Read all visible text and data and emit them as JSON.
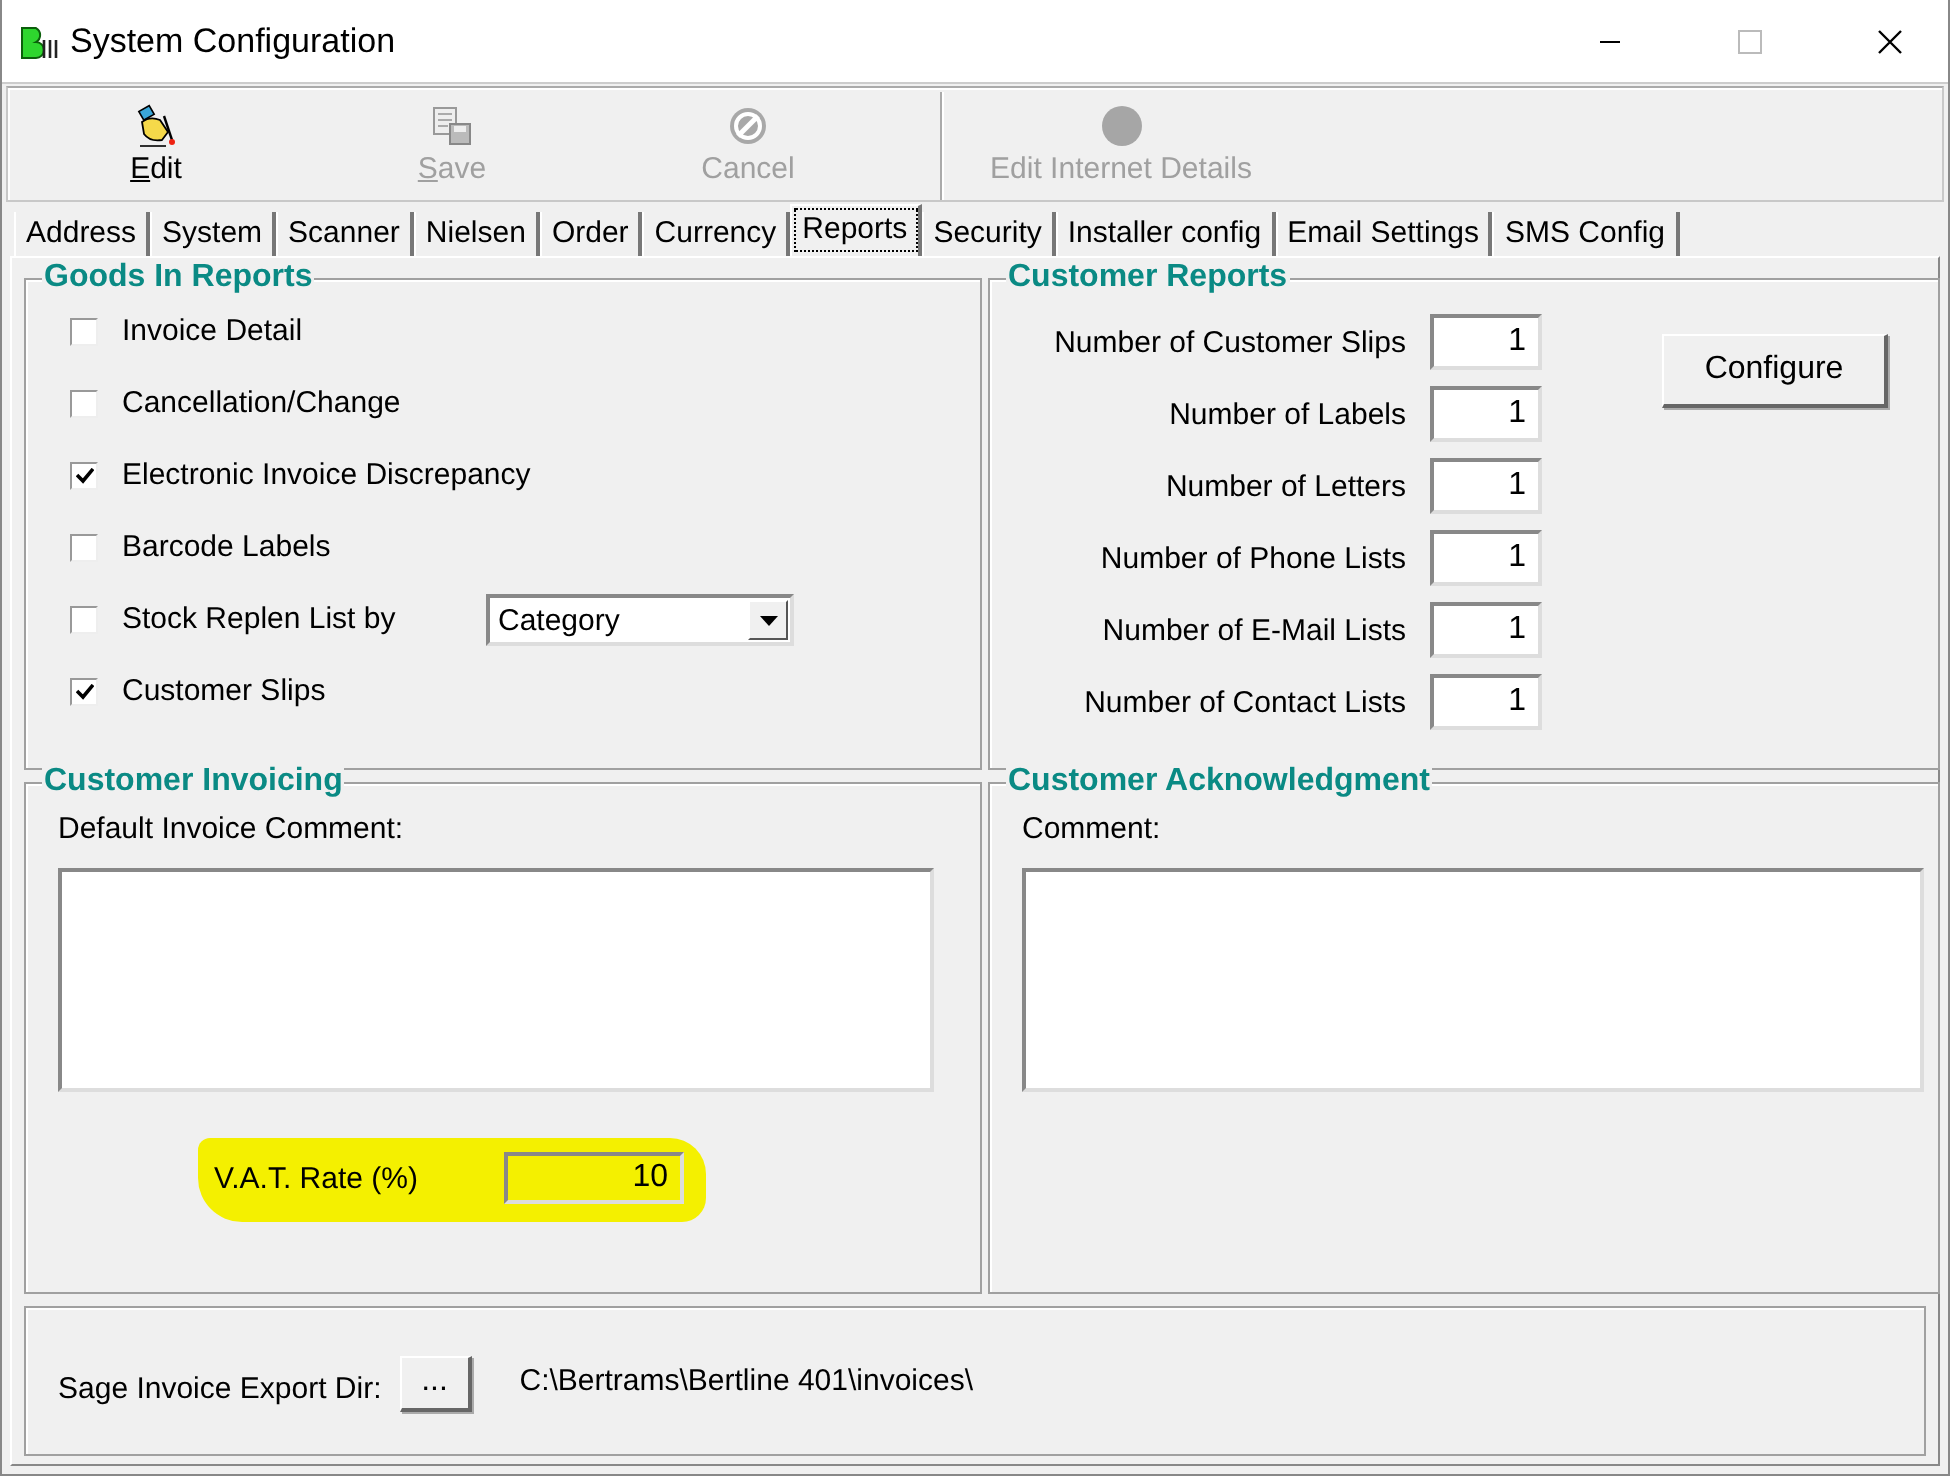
{
  "window": {
    "title": "System Configuration"
  },
  "toolbar": [
    {
      "label": "Edit",
      "kind": "edit",
      "disabled": false,
      "underline_first": true
    },
    {
      "label": "Save",
      "kind": "save",
      "disabled": true,
      "underline_first": true
    },
    {
      "label": "Cancel",
      "kind": "cancel",
      "disabled": true,
      "underline_first": false
    },
    {
      "label": "Edit Internet Details",
      "kind": "internet",
      "disabled": true,
      "underline_first": false
    }
  ],
  "tabs": [
    {
      "label": "Address",
      "selected": false
    },
    {
      "label": "System",
      "selected": false
    },
    {
      "label": "Scanner",
      "selected": false
    },
    {
      "label": "Nielsen",
      "selected": false
    },
    {
      "label": "Order",
      "selected": false
    },
    {
      "label": "Currency",
      "selected": false
    },
    {
      "label": "Reports",
      "selected": true
    },
    {
      "label": "Security",
      "selected": false
    },
    {
      "label": "Installer config",
      "selected": false
    },
    {
      "label": "Email Settings",
      "selected": false
    },
    {
      "label": "SMS Config",
      "selected": false
    }
  ],
  "goods_in_reports": {
    "title": "Goods In Reports",
    "options": [
      {
        "label": "Invoice Detail",
        "checked": false
      },
      {
        "label": "Cancellation/Change",
        "checked": false
      },
      {
        "label": "Electronic Invoice Discrepancy",
        "checked": true
      },
      {
        "label": "Barcode Labels",
        "checked": false
      },
      {
        "label": "Stock Replen List by",
        "checked": false,
        "dropdown": "Category"
      },
      {
        "label": "Customer Slips",
        "checked": true
      }
    ]
  },
  "customer_reports": {
    "title": "Customer Reports",
    "fields": [
      {
        "label": "Number of Customer Slips",
        "value": "1"
      },
      {
        "label": "Number of Labels",
        "value": "1"
      },
      {
        "label": "Number of Letters",
        "value": "1"
      },
      {
        "label": "Number of Phone Lists",
        "value": "1"
      },
      {
        "label": "Number of E-Mail Lists",
        "value": "1"
      },
      {
        "label": "Number of Contact Lists",
        "value": "1"
      }
    ],
    "button": "Configure"
  },
  "customer_invoicing": {
    "title": "Customer Invoicing",
    "comment_label": "Default Invoice Comment:",
    "vat_label": "V.A.T. Rate (%)",
    "vat_value": "10",
    "vat_highlighted": true
  },
  "customer_acknowledgment": {
    "title": "Customer Acknowledgment",
    "comment_label": "Comment:"
  },
  "export": {
    "label": "Sage Invoice Export Dir:",
    "browse": "...",
    "path": "C:\\Bertrams\\Bertline 401\\invoices\\"
  }
}
